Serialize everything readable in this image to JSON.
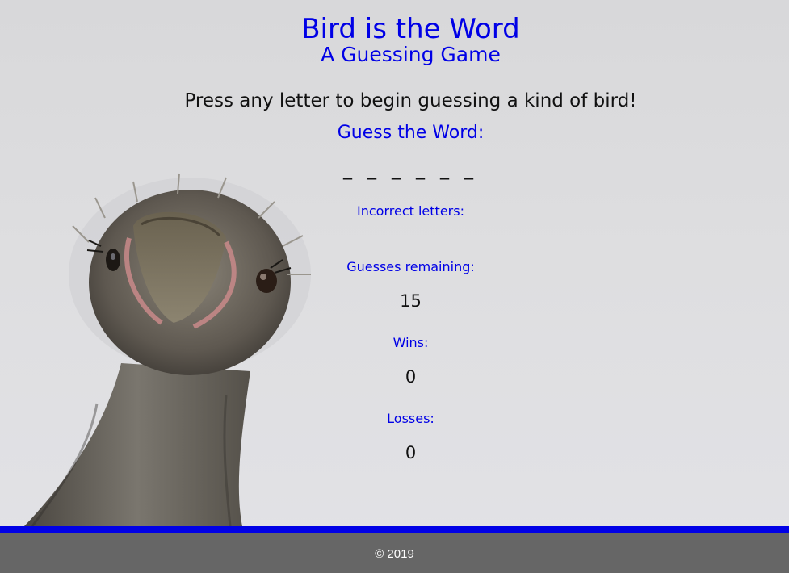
{
  "header": {
    "title": "Bird is the Word",
    "subtitle": "A Guessing Game"
  },
  "instructions": "Press any letter to begin guessing a kind of bird!",
  "game": {
    "guess_heading": "Guess the Word:",
    "word_blanks": "_ _ _ _ _ _",
    "incorrect_label": "Incorrect letters:",
    "incorrect_letters": "",
    "guesses_remaining_label": "Guesses remaining:",
    "guesses_remaining": "15",
    "wins_label": "Wins:",
    "wins": "0",
    "losses_label": "Losses:",
    "losses": "0"
  },
  "footer": {
    "copyright": "© 2019"
  },
  "colors": {
    "accent": "#0000e6",
    "footer_bg": "#666666",
    "background": "#dcdcde"
  },
  "background_image": "ostrich-head-photo"
}
